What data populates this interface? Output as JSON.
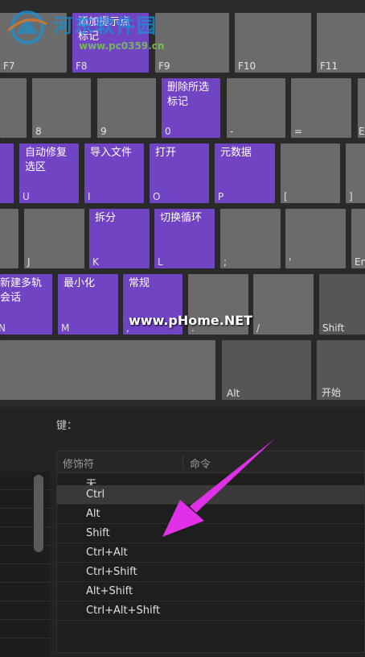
{
  "keyboard": {
    "row1": [
      {
        "id": "f7",
        "label": "F7",
        "cmd": "",
        "purple": false
      },
      {
        "id": "f8",
        "label": "F8",
        "cmd": "添加提示点\n标记",
        "purple": true
      },
      {
        "id": "f9",
        "label": "F9",
        "cmd": "",
        "purple": false
      },
      {
        "id": "f10",
        "label": "F10",
        "cmd": "",
        "purple": false
      },
      {
        "id": "f11",
        "label": "F11",
        "cmd": "",
        "purple": false
      }
    ],
    "row2": [
      {
        "id": "7",
        "label": "",
        "cmd": "",
        "purple": false
      },
      {
        "id": "8",
        "label": "8",
        "cmd": "",
        "purple": false
      },
      {
        "id": "9",
        "label": "9",
        "cmd": "",
        "purple": false
      },
      {
        "id": "0",
        "label": "0",
        "cmd": "删除所选\n标记",
        "purple": true
      },
      {
        "id": "minus",
        "label": "-",
        "cmd": "",
        "purple": false
      },
      {
        "id": "equal",
        "label": "=",
        "cmd": "",
        "purple": false
      },
      {
        "id": "backspace",
        "label": "E",
        "cmd": "",
        "purple": false
      }
    ],
    "row3": [
      {
        "id": "y",
        "label": "",
        "cmd": "",
        "purple": true
      },
      {
        "id": "u",
        "label": "U",
        "cmd": "自动修复\n选区",
        "purple": true
      },
      {
        "id": "i",
        "label": "I",
        "cmd": "导入文件",
        "purple": true
      },
      {
        "id": "o",
        "label": "O",
        "cmd": "打开",
        "purple": true
      },
      {
        "id": "p",
        "label": "P",
        "cmd": "元数据",
        "purple": true
      },
      {
        "id": "lbracket",
        "label": "[",
        "cmd": "",
        "purple": false
      },
      {
        "id": "rbracket",
        "label": "]",
        "cmd": "",
        "purple": false
      }
    ],
    "row4": [
      {
        "id": "h",
        "label": "",
        "cmd": "",
        "purple": false
      },
      {
        "id": "j",
        "label": "J",
        "cmd": "",
        "purple": false
      },
      {
        "id": "k",
        "label": "K",
        "cmd": "拆分",
        "purple": true
      },
      {
        "id": "l",
        "label": "L",
        "cmd": "切换循环",
        "purple": true
      },
      {
        "id": "semicolon",
        "label": ";",
        "cmd": "",
        "purple": false
      },
      {
        "id": "quote",
        "label": "'",
        "cmd": "",
        "purple": false
      },
      {
        "id": "enter",
        "label": "En",
        "cmd": "",
        "purple": false
      }
    ],
    "row5": [
      {
        "id": "n",
        "label": "N",
        "cmd": "新建多轨\n会话",
        "purple": true
      },
      {
        "id": "m",
        "label": "M",
        "cmd": "最小化",
        "purple": true
      },
      {
        "id": "comma",
        "label": ",",
        "cmd": "常规",
        "purple": true
      },
      {
        "id": "period",
        "label": ".",
        "cmd": "",
        "purple": false
      },
      {
        "id": "slash",
        "label": "/",
        "cmd": "",
        "purple": false
      },
      {
        "id": "shift",
        "label": "Shift",
        "cmd": "",
        "purple": false
      }
    ],
    "row6": [
      {
        "id": "space",
        "label": "",
        "cmd": "",
        "purple": false
      },
      {
        "id": "alt",
        "label": "Alt",
        "cmd": "",
        "purple": false
      },
      {
        "id": "start",
        "label": "开始",
        "cmd": "",
        "purple": false
      }
    ]
  },
  "watermark": {
    "site_name": "河东软件园",
    "site_url": "www.pc0359.cn",
    "overlay": "www.pHome.NET"
  },
  "panel": {
    "key_label": "键：",
    "columns": [
      "修饰符",
      "命令"
    ],
    "modifiers": [
      "无",
      "Ctrl",
      "Alt",
      "Shift",
      "Ctrl+Alt",
      "Ctrl+Shift",
      "Alt+Shift",
      "Ctrl+Alt+Shift"
    ],
    "selected_index": 1
  },
  "colors": {
    "accent_purple": "#7144c4",
    "key_gray": "#6b6b6b",
    "arrow_magenta": "#e030e8",
    "background": "#232323"
  }
}
